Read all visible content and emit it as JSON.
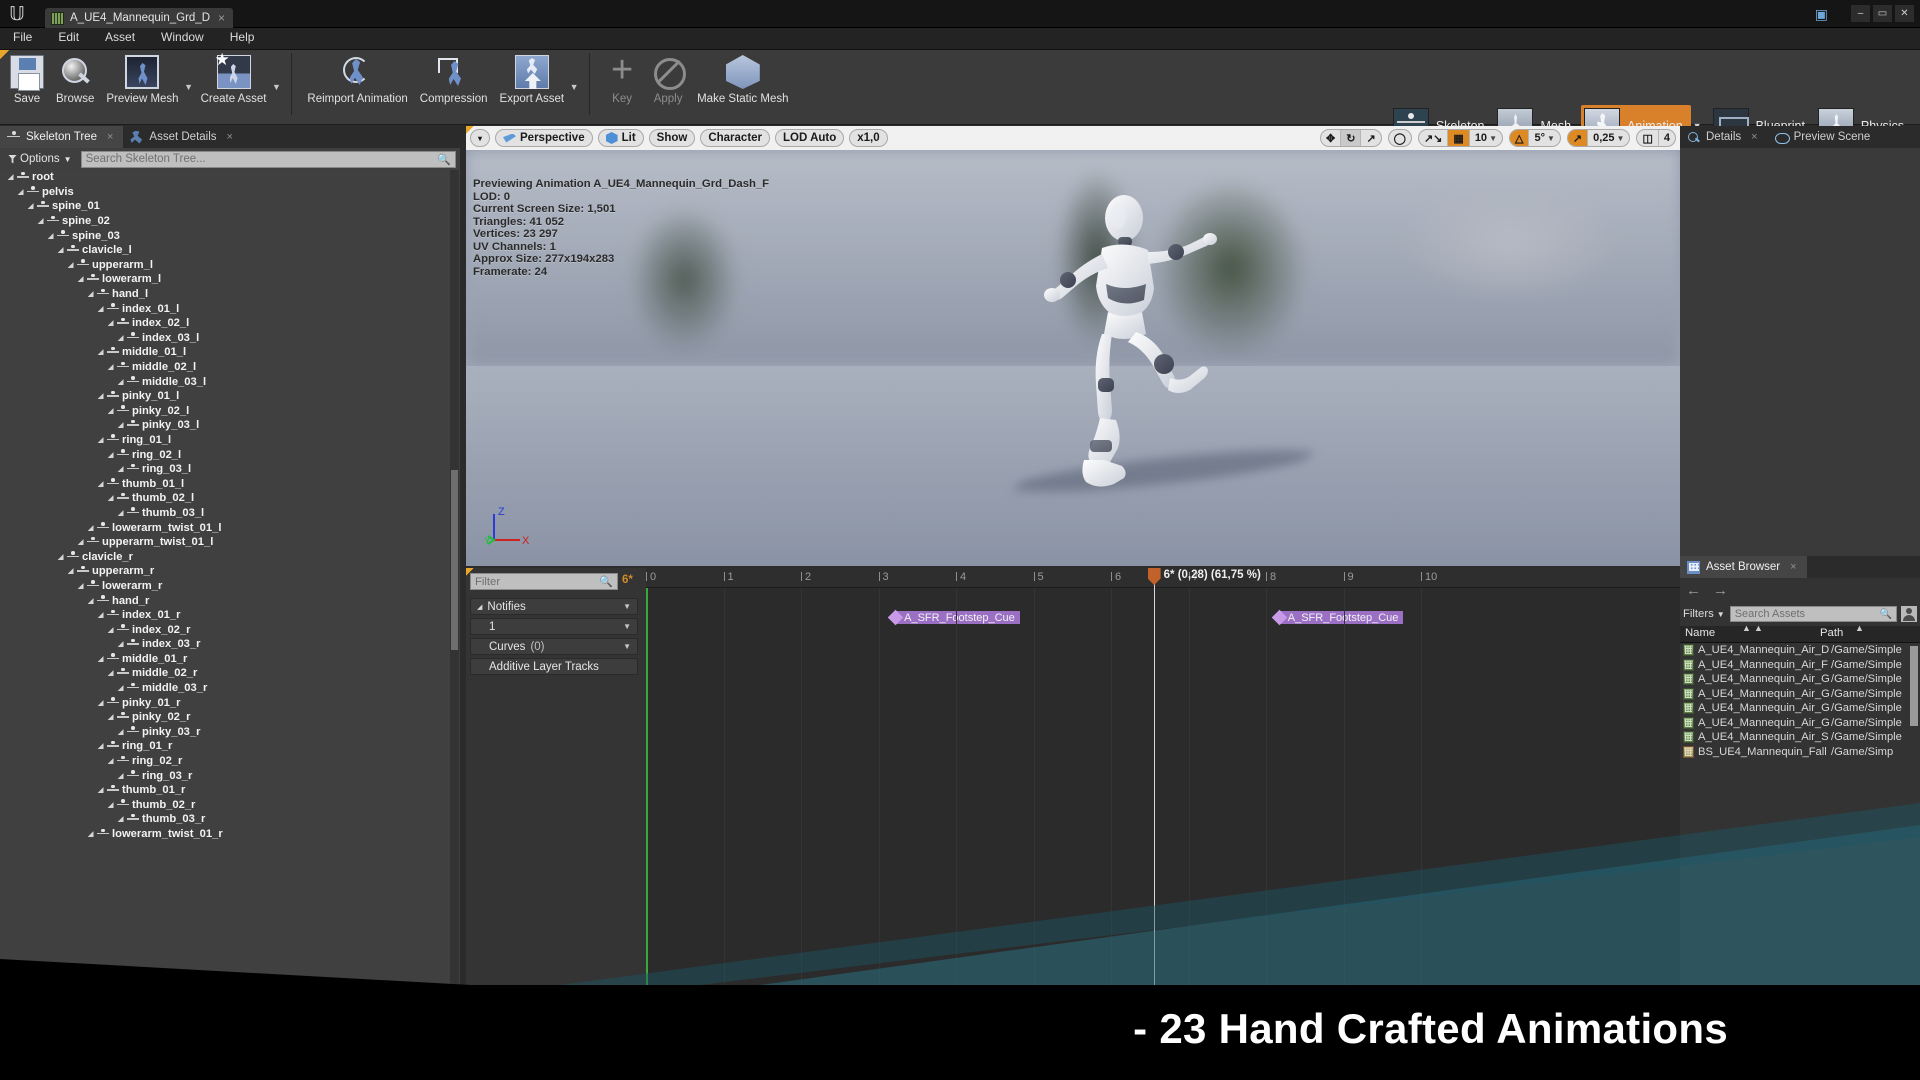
{
  "titlebar": {
    "logo": "unreal-logo",
    "tab_label": "A_UE4_Mannequin_Grd_D",
    "tab_close": "×",
    "console_icon": "console-icon",
    "min": "–",
    "max": "▭",
    "close": "✕"
  },
  "menubar": {
    "items": [
      "File",
      "Edit",
      "Asset",
      "Window",
      "Help"
    ]
  },
  "toolbar": {
    "groups": [
      {
        "buttons": [
          {
            "label": "Save",
            "icon": "save-icon",
            "dropdown": false,
            "disabled": false
          },
          {
            "label": "Browse",
            "icon": "browse-icon",
            "dropdown": false,
            "disabled": false
          },
          {
            "label": "Preview Mesh",
            "icon": "preview-mesh-icon",
            "dropdown": true,
            "disabled": false
          },
          {
            "label": "Create Asset",
            "icon": "create-asset-icon",
            "dropdown": true,
            "disabled": false
          }
        ]
      },
      {
        "buttons": [
          {
            "label": "Reimport Animation",
            "icon": "reimport-animation-icon",
            "dropdown": false,
            "disabled": false
          },
          {
            "label": "Compression",
            "icon": "compression-icon",
            "dropdown": false,
            "disabled": false
          },
          {
            "label": "Export Asset",
            "icon": "export-asset-icon",
            "dropdown": true,
            "disabled": false
          }
        ]
      },
      {
        "buttons": [
          {
            "label": "Key",
            "icon": "key-plus-icon",
            "dropdown": false,
            "disabled": true
          },
          {
            "label": "Apply",
            "icon": "apply-icon",
            "dropdown": false,
            "disabled": true
          },
          {
            "label": "Make Static Mesh",
            "icon": "make-static-mesh-icon",
            "dropdown": false,
            "disabled": false
          }
        ]
      }
    ],
    "modes": [
      {
        "label": "Skeleton",
        "icon": "skeleton-mode-icon",
        "active": false,
        "dropdown": false
      },
      {
        "label": "Mesh",
        "icon": "mesh-mode-icon",
        "active": false,
        "dropdown": false
      },
      {
        "label": "Animation",
        "icon": "animation-mode-icon",
        "active": true,
        "dropdown": true
      },
      {
        "label": "Blueprint",
        "icon": "blueprint-mode-icon",
        "active": false,
        "dropdown": false
      },
      {
        "label": "Physics",
        "icon": "physics-mode-icon",
        "active": false,
        "dropdown": false
      }
    ]
  },
  "left_panel": {
    "tabs": [
      {
        "label": "Skeleton Tree",
        "icon": "skeleton-tree-icon",
        "active": true
      },
      {
        "label": "Asset Details",
        "icon": "asset-details-icon",
        "active": false
      }
    ],
    "options_label": "Options",
    "search_placeholder": "Search Skeleton Tree...",
    "bones": [
      {
        "name": "root",
        "depth": 0
      },
      {
        "name": "pelvis",
        "depth": 1
      },
      {
        "name": "spine_01",
        "depth": 2
      },
      {
        "name": "spine_02",
        "depth": 3
      },
      {
        "name": "spine_03",
        "depth": 4
      },
      {
        "name": "clavicle_l",
        "depth": 5
      },
      {
        "name": "upperarm_l",
        "depth": 6
      },
      {
        "name": "lowerarm_l",
        "depth": 7
      },
      {
        "name": "hand_l",
        "depth": 8
      },
      {
        "name": "index_01_l",
        "depth": 9
      },
      {
        "name": "index_02_l",
        "depth": 10
      },
      {
        "name": "index_03_l",
        "depth": 11
      },
      {
        "name": "middle_01_l",
        "depth": 9
      },
      {
        "name": "middle_02_l",
        "depth": 10
      },
      {
        "name": "middle_03_l",
        "depth": 11
      },
      {
        "name": "pinky_01_l",
        "depth": 9
      },
      {
        "name": "pinky_02_l",
        "depth": 10
      },
      {
        "name": "pinky_03_l",
        "depth": 11
      },
      {
        "name": "ring_01_l",
        "depth": 9
      },
      {
        "name": "ring_02_l",
        "depth": 10
      },
      {
        "name": "ring_03_l",
        "depth": 11
      },
      {
        "name": "thumb_01_l",
        "depth": 9
      },
      {
        "name": "thumb_02_l",
        "depth": 10
      },
      {
        "name": "thumb_03_l",
        "depth": 11
      },
      {
        "name": "lowerarm_twist_01_l",
        "depth": 8
      },
      {
        "name": "upperarm_twist_01_l",
        "depth": 7
      },
      {
        "name": "clavicle_r",
        "depth": 5
      },
      {
        "name": "upperarm_r",
        "depth": 6
      },
      {
        "name": "lowerarm_r",
        "depth": 7
      },
      {
        "name": "hand_r",
        "depth": 8
      },
      {
        "name": "index_01_r",
        "depth": 9
      },
      {
        "name": "index_02_r",
        "depth": 10
      },
      {
        "name": "index_03_r",
        "depth": 11
      },
      {
        "name": "middle_01_r",
        "depth": 9
      },
      {
        "name": "middle_02_r",
        "depth": 10
      },
      {
        "name": "middle_03_r",
        "depth": 11
      },
      {
        "name": "pinky_01_r",
        "depth": 9
      },
      {
        "name": "pinky_02_r",
        "depth": 10
      },
      {
        "name": "pinky_03_r",
        "depth": 11
      },
      {
        "name": "ring_01_r",
        "depth": 9
      },
      {
        "name": "ring_02_r",
        "depth": 10
      },
      {
        "name": "ring_03_r",
        "depth": 11
      },
      {
        "name": "thumb_01_r",
        "depth": 9
      },
      {
        "name": "thumb_02_r",
        "depth": 10
      },
      {
        "name": "thumb_03_r",
        "depth": 11
      },
      {
        "name": "lowerarm_twist_01_r",
        "depth": 8
      }
    ]
  },
  "viewport": {
    "toolbar": {
      "menu_caret": "▾",
      "view_mode": "Perspective",
      "lit": "Lit",
      "show": "Show",
      "character": "Character",
      "lod": "LOD Auto",
      "speed": "x1,0"
    },
    "transform_tools": [
      "translate-icon",
      "rotate-icon",
      "scale-icon"
    ],
    "coord_icon": "world-space-icon",
    "surface_snap_icon": "surface-snap-icon",
    "grid_snap": {
      "icon": "grid-snap-icon",
      "value": "10",
      "active": true
    },
    "rotation_snap": {
      "icon": "rotation-snap-icon",
      "value": "5°",
      "active": true
    },
    "scale_snap": {
      "icon": "scale-snap-icon",
      "value": "0,25",
      "active": true
    },
    "camera_speed": "4",
    "stats": [
      "Previewing Animation A_UE4_Mannequin_Grd_Dash_F",
      "LOD: 0",
      "Current Screen Size: 1,501",
      "Triangles: 41 052",
      "Vertices: 23 297",
      "UV Channels: 1",
      "Approx Size: 277x194x283",
      "Framerate: 24"
    ],
    "gizmo_axes": [
      "Z",
      "X",
      "Y"
    ]
  },
  "timeline": {
    "filter_placeholder": "Filter",
    "frame_badge": "6*",
    "rows": [
      {
        "label": "Notifies",
        "extra": "",
        "collapsible": true
      },
      {
        "label": "1",
        "extra": "",
        "collapsible": false
      },
      {
        "label": "Curves",
        "extra": "(0)",
        "collapsible": false
      },
      {
        "label": "Additive Layer Tracks",
        "extra": "",
        "collapsible": false
      }
    ],
    "ticks": [
      "0",
      "1",
      "2",
      "3",
      "4",
      "5",
      "6",
      "7",
      "8",
      "9",
      "10"
    ],
    "playhead_label": "6* (0,28) (61,75 %)",
    "notifies": [
      {
        "label": "A_SFR_Footstep_Cue",
        "time": 3.15
      },
      {
        "label": "A_SFR_Footstep_Cue",
        "time": 8.1
      }
    ]
  },
  "right_panel": {
    "tabs": [
      {
        "label": "Details",
        "icon": "details-magnifier-icon",
        "active": false
      },
      {
        "label": "Preview Scene",
        "icon": "preview-scene-icon",
        "active": false
      }
    ]
  },
  "asset_browser": {
    "tab_label": "Asset Browser",
    "tab_icon": "asset-browser-icon",
    "back_icon": "←",
    "forward_icon": "→",
    "filters_label": "Filters",
    "search_placeholder": "Search Assets",
    "columns": [
      "Name",
      "Path"
    ],
    "items": [
      {
        "name": "A_UE4_Mannequin_Air_D",
        "path": "/Game/Simple",
        "type": "anim"
      },
      {
        "name": "A_UE4_Mannequin_Air_F",
        "path": "/Game/Simple",
        "type": "anim"
      },
      {
        "name": "A_UE4_Mannequin_Air_G",
        "path": "/Game/Simple",
        "type": "anim"
      },
      {
        "name": "A_UE4_Mannequin_Air_G",
        "path": "/Game/Simple",
        "type": "anim"
      },
      {
        "name": "A_UE4_Mannequin_Air_G",
        "path": "/Game/Simple",
        "type": "anim"
      },
      {
        "name": "A_UE4_Mannequin_Air_G",
        "path": "/Game/Simple",
        "type": "anim"
      },
      {
        "name": "A_UE4_Mannequin_Air_S",
        "path": "/Game/Simple",
        "type": "anim"
      },
      {
        "name": "BS_UE4_Mannequin_Fall",
        "path": "/Game/Simp",
        "type": "blend"
      }
    ]
  },
  "promo": {
    "text": "- 23 Hand Crafted Animations"
  }
}
